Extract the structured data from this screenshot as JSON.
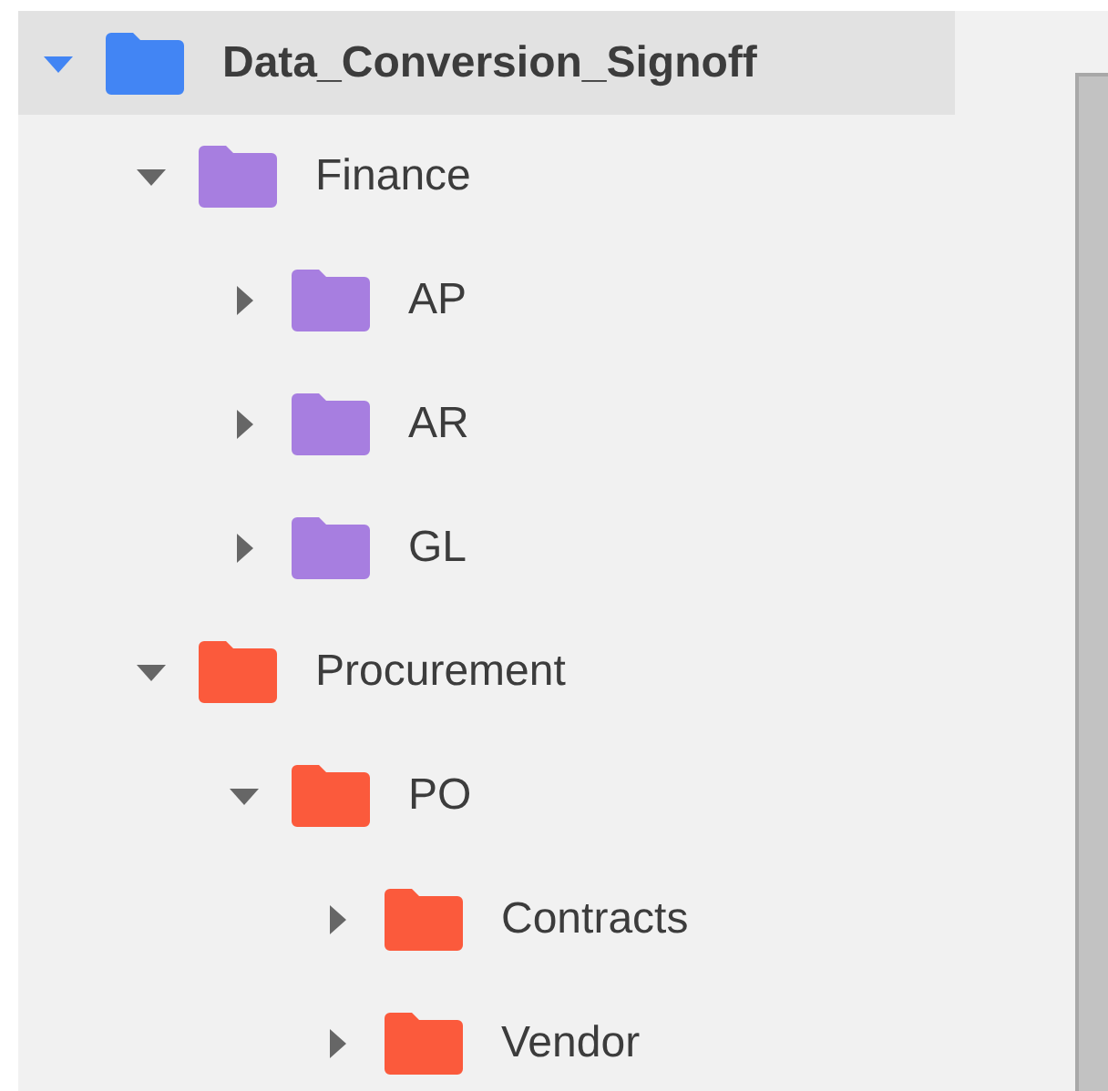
{
  "tree": [
    {
      "label": "Data_Conversion_Signoff",
      "color": "#4285f4",
      "expanded": true,
      "selected": true,
      "children": [
        {
          "label": "Finance",
          "color": "#a77ee0",
          "expanded": true,
          "selected": false,
          "children": [
            {
              "label": "AP",
              "color": "#a77ee0",
              "expanded": false,
              "selected": false
            },
            {
              "label": "AR",
              "color": "#a77ee0",
              "expanded": false,
              "selected": false
            },
            {
              "label": "GL",
              "color": "#a77ee0",
              "expanded": false,
              "selected": false
            }
          ]
        },
        {
          "label": "Procurement",
          "color": "#fb5a3c",
          "expanded": true,
          "selected": false,
          "children": [
            {
              "label": "PO",
              "color": "#fb5a3c",
              "expanded": true,
              "selected": false,
              "children": [
                {
                  "label": "Contracts",
                  "color": "#fb5a3c",
                  "expanded": false,
                  "selected": false
                },
                {
                  "label": "Vendor",
                  "color": "#fb5a3c",
                  "expanded": false,
                  "selected": false
                }
              ]
            }
          ]
        }
      ]
    }
  ]
}
